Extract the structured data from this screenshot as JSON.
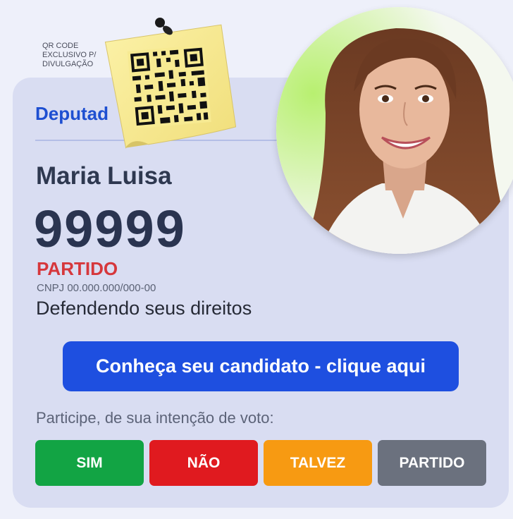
{
  "qr": {
    "caption_lines": [
      "QR CODE",
      "EXCLUSIVO P/",
      "DIVULGAÇÃO"
    ]
  },
  "candidate": {
    "office": "Deputad",
    "name": "Maria Luisa",
    "number": "99999",
    "party": "PARTIDO",
    "cnpj": "CNPJ 00.000.000/000-00",
    "slogan": "Defendendo seus direitos"
  },
  "cta": {
    "label": "Conheça seu candidato - clique aqui"
  },
  "vote": {
    "prompt": "Participe, de sua intenção de voto:",
    "options": [
      "SIM",
      "NÃO",
      "TALVEZ",
      "PARTIDO"
    ]
  },
  "colors": {
    "accent_blue": "#1e4fe0",
    "party_red": "#d6373c",
    "sim": "#12a444",
    "nao": "#e01a1f",
    "talvez": "#f79a12",
    "partido": "#6b717e"
  },
  "icons": [
    "pushpin-icon",
    "qr-code-icon"
  ]
}
